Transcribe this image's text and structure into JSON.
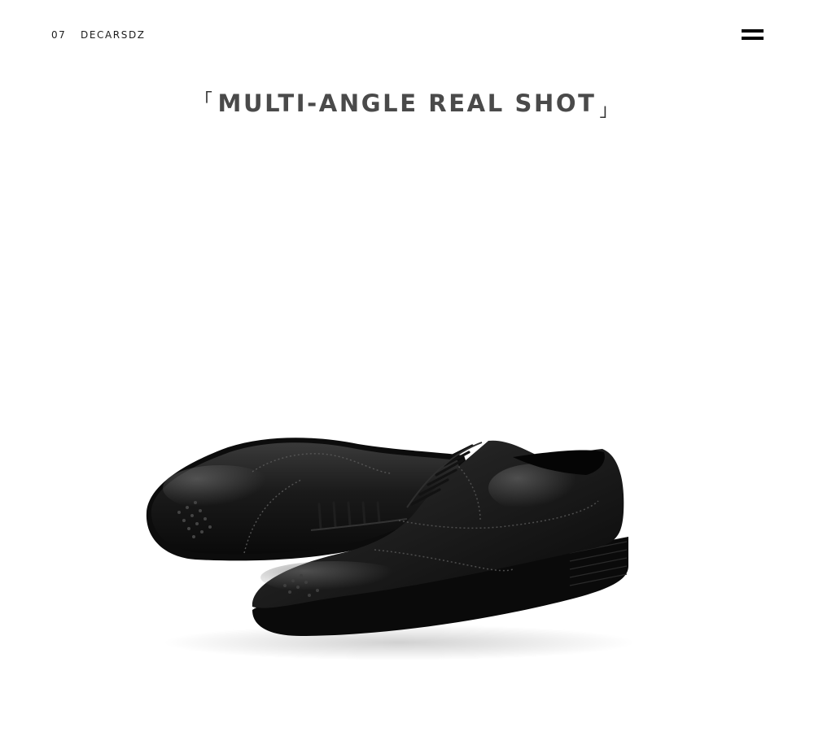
{
  "header": {
    "page_number": "07",
    "brand": "DECARSDZ",
    "menu_icon": "hamburger-menu-icon"
  },
  "section": {
    "bracket_open": "「",
    "title": "MULTI-ANGLE REAL SHOT",
    "bracket_close": "」"
  },
  "photo": {
    "subject": "shoe-pair-image"
  }
}
